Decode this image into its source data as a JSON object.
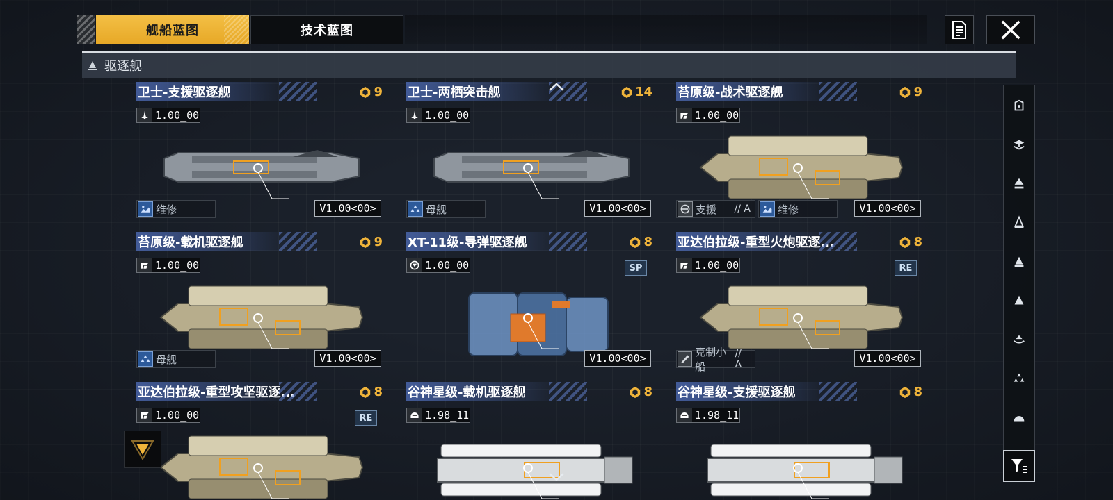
{
  "tabs": [
    {
      "label": "舰船蓝图",
      "active": true
    },
    {
      "label": "技术蓝图",
      "active": false
    }
  ],
  "category": {
    "label": "驱逐舰"
  },
  "colors": {
    "accent": "#f0b43a",
    "role_blue": "#2d5a9a"
  },
  "cards": [
    {
      "name": "卫士-支援驱逐舰",
      "cost": "9",
      "version": "1.00_00",
      "ver_icon": "fighter-icon",
      "tag": "",
      "roles": [
        {
          "label": "维修",
          "grade": "",
          "icon": "repair-icon"
        }
      ],
      "vtag": "V1.00<00>",
      "ship": "grey"
    },
    {
      "name": "卫士-两栖突击舰",
      "cost": "14",
      "version": "1.00_00",
      "ver_icon": "fighter-icon",
      "tag": "",
      "roles": [
        {
          "label": "母舰",
          "grade": "",
          "icon": "carrier-icon"
        }
      ],
      "vtag": "V1.00<00>",
      "ship": "grey"
    },
    {
      "name": "苔原级-战术驱逐舰",
      "cost": "9",
      "version": "1.00_00",
      "ver_icon": "faction-icon",
      "tag": "",
      "roles": [
        {
          "label": "支援",
          "grade": "// A",
          "icon": "support-icon"
        },
        {
          "label": "维修",
          "grade": "",
          "icon": "repair-icon"
        }
      ],
      "vtag": "V1.00<00>",
      "ship": "tan"
    },
    {
      "name": "苔原级-载机驱逐舰",
      "cost": "9",
      "version": "1.00_00",
      "ver_icon": "faction-icon",
      "tag": "",
      "roles": [
        {
          "label": "母舰",
          "grade": "",
          "icon": "carrier-icon"
        }
      ],
      "vtag": "V1.00<00>",
      "ship": "tan"
    },
    {
      "name": "XT-11级-导弹驱逐舰",
      "cost": "8",
      "version": "1.00_00",
      "ver_icon": "ring-icon",
      "tag": "SP",
      "roles": [],
      "vtag": "V1.00<00>",
      "ship": "blue"
    },
    {
      "name": "亚达伯拉级-重型火炮驱逐...",
      "cost": "8",
      "version": "1.00_00",
      "ver_icon": "faction-icon",
      "tag": "RE",
      "roles": [
        {
          "label": "克制小船",
          "grade": "// A",
          "icon": "counter-icon"
        }
      ],
      "vtag": "V1.00<00>",
      "ship": "tan"
    },
    {
      "name": "亚达伯拉级-重型攻坚驱逐...",
      "cost": "8",
      "version": "1.00_00",
      "ver_icon": "faction-icon",
      "tag": "RE",
      "roles": [],
      "vtag": "",
      "ship": "tan"
    },
    {
      "name": "谷神星级-载机驱逐舰",
      "cost": "8",
      "version": "1.98_11",
      "ver_icon": "helmet-icon",
      "tag": "",
      "roles": [],
      "vtag": "",
      "ship": "white"
    },
    {
      "name": "谷神星级-支援驱逐舰",
      "cost": "8",
      "version": "1.98_11",
      "ver_icon": "helmet-icon",
      "tag": "",
      "roles": [],
      "vtag": "",
      "ship": "white"
    }
  ],
  "rail": [
    "flagship-icon",
    "frigate-class-icon",
    "corvette-icon",
    "destroyer-icon",
    "cruiser-icon",
    "battlecruiser-icon",
    "carrier-class-icon",
    "auxiliary-icon",
    "dome-icon"
  ]
}
